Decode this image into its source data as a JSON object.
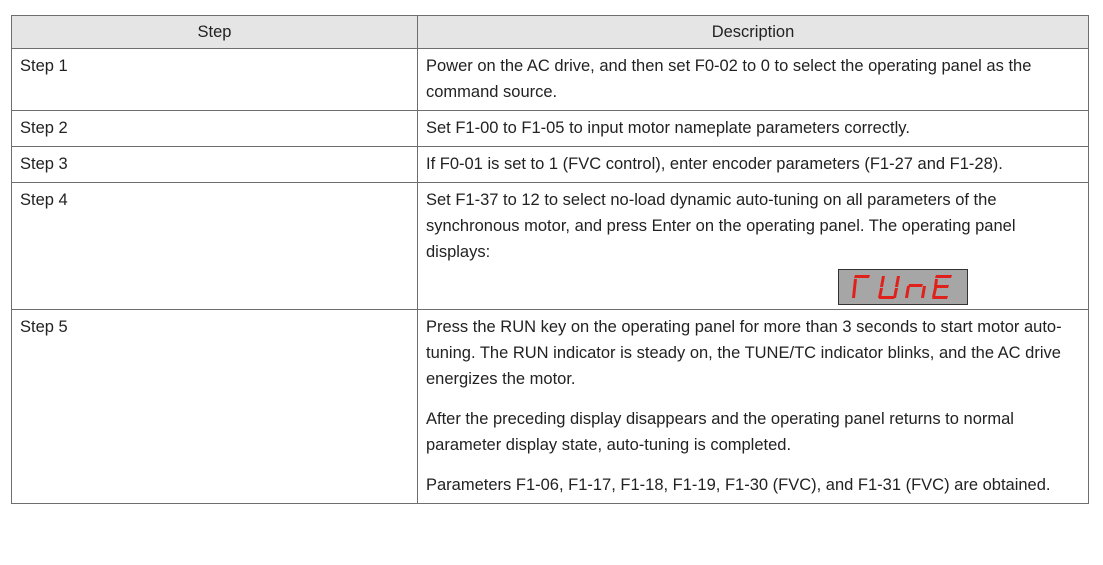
{
  "table": {
    "headers": [
      "Step",
      "Description"
    ],
    "rows": [
      {
        "step": "Step 1",
        "paragraphs": [
          "Power on the AC drive, and then set F0-02 to 0 to select the operating panel as the command source."
        ]
      },
      {
        "step": "Step 2",
        "paragraphs": [
          "Set F1-00 to F1-05 to input motor nameplate parameters correctly."
        ]
      },
      {
        "step": "Step 3",
        "paragraphs": [
          "If F0-01 is set to 1 (FVC control), enter encoder parameters (F1-27 and F1-28)."
        ]
      },
      {
        "step": "Step 4",
        "paragraphs": [
          "Set F1-37 to 12 to select no-load dynamic auto-tuning on all parameters of the synchronous motor, and press Enter on the operating panel. The operating panel displays:"
        ],
        "display": "TUNE"
      },
      {
        "step": "Step 5",
        "paragraphs": [
          "Press the RUN key on the operating panel for more than 3 seconds to start motor auto-tuning. The RUN indicator is steady on, the TUNE/TC indicator blinks, and the AC drive energizes the motor.",
          "After the preceding display disappears and the operating panel returns to normal parameter display state, auto-tuning is completed.",
          "Parameters F1-06, F1-17, F1-18, F1-19, F1-30 (FVC), and F1-31 (FVC) are obtained."
        ]
      }
    ]
  },
  "colors": {
    "header_bg": "#e5e5e5",
    "border": "#6e6e6e",
    "panel_bg": "#a6a6a6",
    "segment_red": "#e0201b"
  }
}
